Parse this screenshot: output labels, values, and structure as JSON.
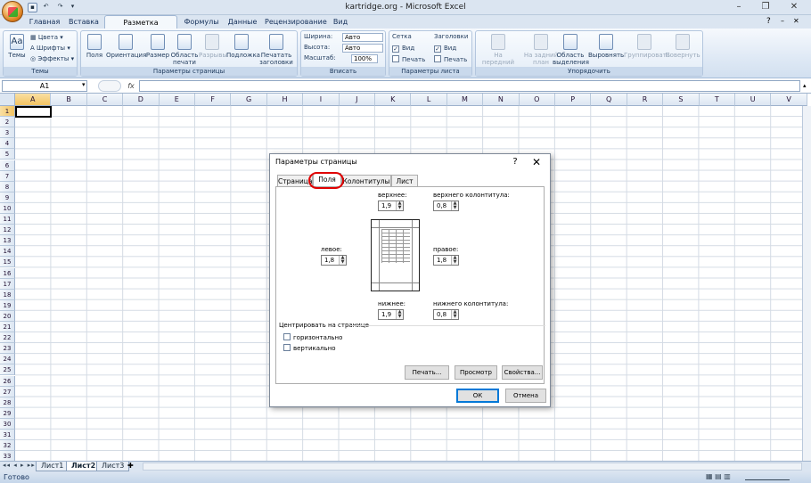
{
  "window": {
    "title": "kartridge.org - Microsoft Excel"
  },
  "ribbon_tabs": [
    "Главная",
    "Вставка",
    "Разметка страницы",
    "Формулы",
    "Данные",
    "Рецензирование",
    "Вид"
  ],
  "ribbon": {
    "themes": {
      "themes_label": "Темы",
      "colors": "Цвета",
      "fonts": "Шрифты",
      "effects": "Эффекты",
      "group": "Темы"
    },
    "page_setup": {
      "margins": "Поля",
      "orientation": "Ориентация",
      "size": "Размер",
      "print_area": "Область печати",
      "breaks": "Разрывы",
      "background": "Подложка",
      "print_titles": "Печатать заголовки",
      "group": "Параметры страницы"
    },
    "scale": {
      "width_label": "Ширина:",
      "width_value": "Авто",
      "height_label": "Высота:",
      "height_value": "Авто",
      "scale_label": "Масштаб:",
      "scale_value": "100%",
      "group": "Вписать"
    },
    "sheet_options": {
      "grid": "Сетка",
      "headings": "Заголовки",
      "view": "Вид",
      "print": "Печать",
      "group": "Параметры листа"
    },
    "arrange": {
      "bring_forward": "На передний план",
      "send_back": "На задний план",
      "selection_pane": "Область выделения",
      "align": "Выровнять",
      "group_btn": "Группировать",
      "rotate": "Повернуть",
      "group": "Упорядочить"
    }
  },
  "formula_bar": {
    "name_box": "A1",
    "fx": "fx",
    "formula": ""
  },
  "columns": [
    "A",
    "B",
    "C",
    "D",
    "E",
    "F",
    "G",
    "H",
    "I",
    "J",
    "K",
    "L",
    "M",
    "N",
    "O",
    "P",
    "Q",
    "R",
    "S",
    "T",
    "U",
    "V"
  ],
  "rows": [
    "1",
    "2",
    "3",
    "4",
    "5",
    "6",
    "7",
    "8",
    "9",
    "10",
    "11",
    "12",
    "13",
    "14",
    "15",
    "16",
    "17",
    "18",
    "19",
    "20",
    "21",
    "22",
    "23",
    "24",
    "25",
    "26",
    "27",
    "28",
    "29",
    "30",
    "31",
    "32",
    "33"
  ],
  "sheet_tabs": [
    "Лист1",
    "Лист2",
    "Лист3"
  ],
  "active_sheet": "Лист2",
  "status": "Готово",
  "dialog": {
    "title": "Параметры страницы",
    "help": "?",
    "close": "✕",
    "tabs": [
      "Страница",
      "Поля",
      "Колонтитулы",
      "Лист"
    ],
    "active_tab": "Поля",
    "top_label": "верхнее:",
    "top_value": "1,9",
    "header_label": "верхнего колонтитула:",
    "header_value": "0,8",
    "left_label": "левое:",
    "left_value": "1,8",
    "right_label": "правое:",
    "right_value": "1,8",
    "bottom_label": "нижнее:",
    "bottom_value": "1,9",
    "footer_label": "нижнего колонтитула:",
    "footer_value": "0,8",
    "center_label": "Центрировать на странице",
    "horizontal": "горизонтально",
    "vertical": "вертикально",
    "print_btn": "Печать...",
    "preview_btn": "Просмотр",
    "properties_btn": "Свойства...",
    "ok": "ОК",
    "cancel": "Отмена"
  },
  "colors": {
    "highlight": "#e00000",
    "ribbon": "#dbe5f1"
  }
}
